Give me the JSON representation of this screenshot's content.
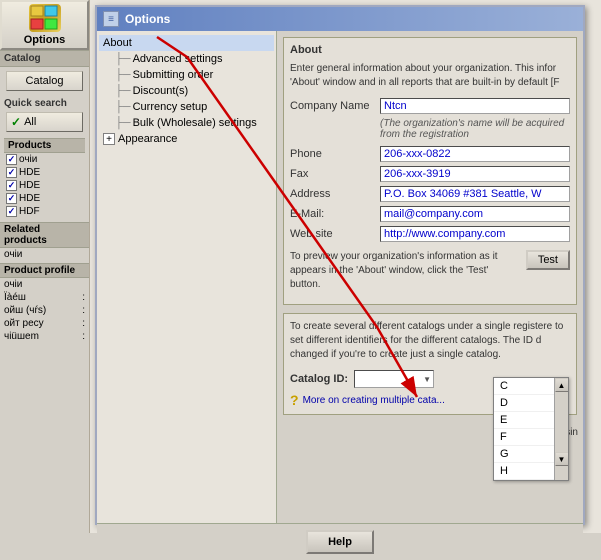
{
  "sidebar": {
    "options_label": "Options",
    "catalog_section_label": "Catalog",
    "catalog_btn_label": "Catalog",
    "quicksearch_label": "Quick search",
    "all_btn_label": "All",
    "products_label": "Products",
    "products": [
      {
        "name": "очіи",
        "checked": true
      },
      {
        "name": "HDE",
        "checked": true
      },
      {
        "name": "HDE",
        "checked": true
      },
      {
        "name": "HDE",
        "checked": true
      },
      {
        "name": "HDF",
        "checked": true
      }
    ],
    "related_products_label": "Related products",
    "related_item": "очіи",
    "product_profile_label": "Product profile",
    "profile_item": "очіи",
    "profile_rows": [
      {
        "label": "Ïàéш",
        "value": ":"
      },
      {
        "label": "ойш (чŕs)",
        "value": ":"
      },
      {
        "label": "ойт ресу",
        "value": ":"
      },
      {
        "label": "чіüшem",
        "value": ":"
      }
    ]
  },
  "options_window": {
    "title": "Options",
    "tree": [
      {
        "label": "About",
        "selected": true,
        "indent": 0,
        "has_expander": false
      },
      {
        "label": "Advanced settings",
        "selected": false,
        "indent": 1,
        "has_expander": false
      },
      {
        "label": "Submitting order",
        "selected": false,
        "indent": 1,
        "has_expander": false
      },
      {
        "label": "Discount(s)",
        "selected": false,
        "indent": 1,
        "has_expander": false
      },
      {
        "label": "Currency setup",
        "selected": false,
        "indent": 1,
        "has_expander": false
      },
      {
        "label": "Bulk (Wholesale) settings",
        "selected": false,
        "indent": 1,
        "has_expander": false
      },
      {
        "label": "Appearance",
        "selected": false,
        "indent": 0,
        "has_expander": true
      }
    ],
    "about_group_title": "About",
    "about_desc": "Enter general information about your organization. This infor 'About' window and in all reports that are built-in by default [F",
    "fields": [
      {
        "label": "Company Name",
        "value": "Ntcn"
      },
      {
        "label": "Phone",
        "value": "206-xxx-0822"
      },
      {
        "label": "Fax",
        "value": "206-xxx-3919"
      },
      {
        "label": "Address",
        "value": "P.O. Box 34069 #381 Seattle, W"
      },
      {
        "label": "E-Mail:",
        "value": "mail@company.com"
      },
      {
        "label": "Web site",
        "value": "http://www.company.com"
      }
    ],
    "company_note": "(The organization's name will be acquired from the registration",
    "preview_text": "To preview your organization's information as it appears in the 'About' window, click the 'Test' button.",
    "test_btn_label": "Test",
    "catalog_desc": "To create several different catalogs under a single registere to set different identifiers for the different catalogs. The ID d changed if you're to create just a single catalog.",
    "catalog_id_label": "Catalog ID:",
    "catalog_dropdown_value": "",
    "dropdown_items": [
      "C",
      "D",
      "E",
      "F",
      "G",
      "H"
    ],
    "more_link": "More on creating multiple cata...",
    "help_btn_label": "Help",
    "sin_text": "sin"
  },
  "arrow": {
    "color": "#cc0000"
  }
}
